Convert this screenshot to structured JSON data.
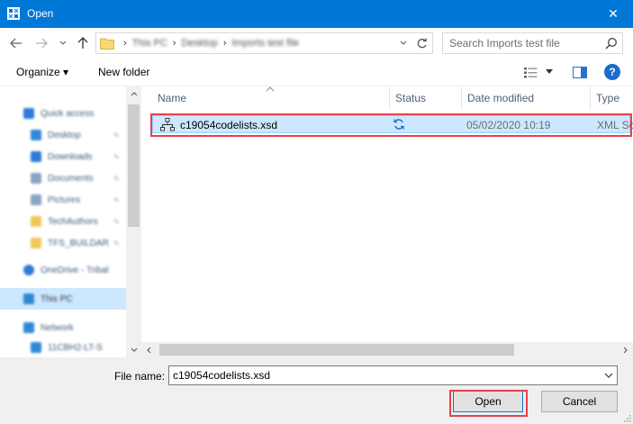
{
  "window": {
    "title": "Open",
    "close_glyph": "✕"
  },
  "address": {
    "crumbs": [
      "This PC",
      "Desktop",
      "Imports test file"
    ],
    "separator": "›"
  },
  "search": {
    "placeholder": "Search Imports test file"
  },
  "toolbar": {
    "organize_label": "Organize ▾",
    "new_folder_label": "New folder",
    "help_glyph": "?"
  },
  "navpane": {
    "items": [
      {
        "label": "Quick access",
        "icon": "star-icon",
        "color": "#2f7ad8"
      },
      {
        "label": "Desktop",
        "icon": "desktop-icon",
        "color": "#2f89d8"
      },
      {
        "label": "Downloads",
        "icon": "download-icon",
        "color": "#2f7ad8"
      },
      {
        "label": "Documents",
        "icon": "documents-icon",
        "color": "#8aa4c4"
      },
      {
        "label": "Pictures",
        "icon": "pictures-icon",
        "color": "#8aa4c4"
      },
      {
        "label": "TechAuthors",
        "icon": "folder-icon",
        "color": "#f0c75a"
      },
      {
        "label": "TFS_BUILDAR",
        "icon": "folder-icon",
        "color": "#f0c75a"
      },
      {
        "label": "OneDrive - Tribal",
        "icon": "cloud-icon",
        "color": "#2f7ad8"
      },
      {
        "label": "This PC",
        "icon": "computer-icon",
        "color": "#2f89d8"
      },
      {
        "label": "Network",
        "icon": "network-icon",
        "color": "#2f89d8"
      },
      {
        "label": "11CBH2-LT-S",
        "icon": "computer-icon",
        "color": "#2f89d8"
      }
    ]
  },
  "columns": {
    "name": "Name",
    "status": "Status",
    "date": "Date modified",
    "type": "Type"
  },
  "files": [
    {
      "name": "c19054codelists.xsd",
      "date": "05/02/2020 10:19",
      "type": "XML Sc"
    }
  ],
  "bottom": {
    "file_name_label": "File name:",
    "file_name_value": "c19054codelists.xsd",
    "open_label": "Open",
    "cancel_label": "Cancel"
  },
  "colors": {
    "accent": "#0078d7",
    "selection": "#cce8ff",
    "highlight": "#e8404a"
  }
}
